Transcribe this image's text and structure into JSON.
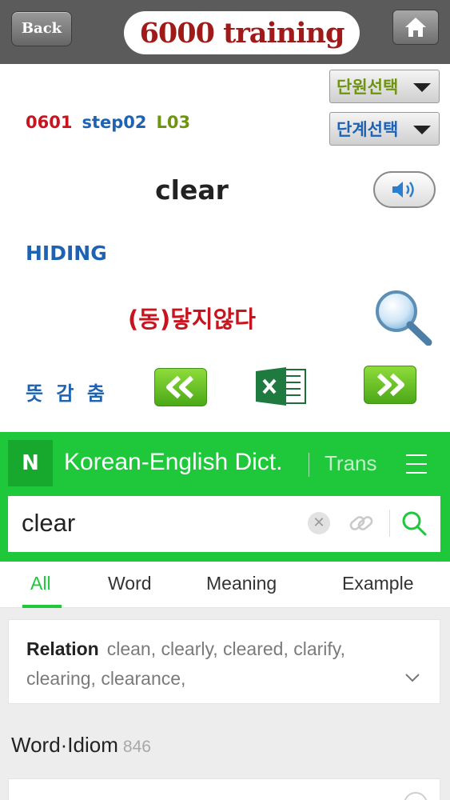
{
  "topbar": {
    "back_label": "Back",
    "title": "6000 training",
    "home_icon": "home-icon"
  },
  "selectors": {
    "unit_label": "단원선택",
    "step_label": "단계선택"
  },
  "lesson": {
    "code": "0601",
    "step": "step02",
    "level": "L03"
  },
  "card": {
    "word": "clear",
    "status": "HIDING",
    "meaning": "(동)닿지않다",
    "hide_label": "뜻 감 춤"
  },
  "icons": {
    "speaker": "speaker-icon",
    "magnifier": "magnifier-icon",
    "prev": "double-left-arrow-icon",
    "excel": "excel-icon",
    "next": "double-right-arrow-icon"
  },
  "dictionary": {
    "logo_letter": "N",
    "title": "Korean-English Dict.",
    "trans_label": "Trans",
    "search_value": "clear",
    "tabs": [
      {
        "label": "All",
        "active": true
      },
      {
        "label": "Word",
        "active": false
      },
      {
        "label": "Meaning",
        "active": false
      },
      {
        "label": "Example",
        "active": false
      }
    ],
    "relation_label": "Relation",
    "relation_words": "clean, clearly, cleared, clarify, clearing, clearance,",
    "idiom_label": "Word·Idiom",
    "idiom_count": "846",
    "accent_color": "#1ec83a"
  },
  "colors": {
    "topbar": "#5b5b5b",
    "red": "#c8141e",
    "blue": "#1e62b4",
    "olive": "#6e9410"
  }
}
